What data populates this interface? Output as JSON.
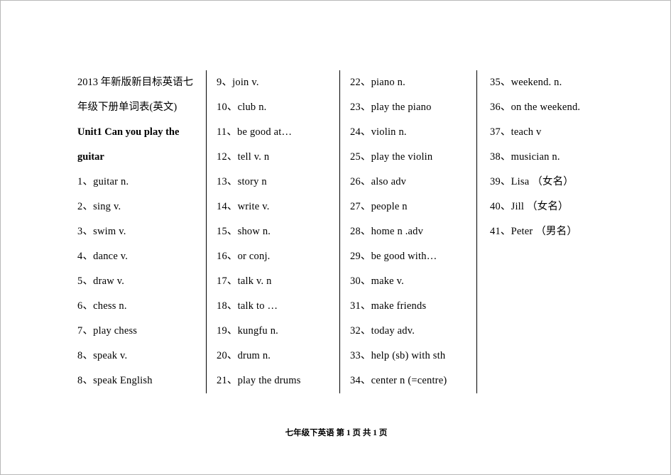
{
  "document": {
    "footer": "七年级下英语   第 1 页 共 1 页",
    "columns": [
      {
        "id": "column-1",
        "lines": [
          {
            "text": "2013 年新版新目标英语七",
            "bold": false
          },
          {
            "text": "年级下册单词表(英文)",
            "bold": false
          },
          {
            "text": "Unit1    Can you play the",
            "bold": true
          },
          {
            "text": "guitar",
            "bold": true
          },
          {
            "text": "1、guitar    n.",
            "bold": false
          },
          {
            "text": "2、sing    v.",
            "bold": false
          },
          {
            "text": "3、swim    v.",
            "bold": false
          },
          {
            "text": "4、dance    v.",
            "bold": false
          },
          {
            "text": "5、draw    v.",
            "bold": false
          },
          {
            "text": "6、chess    n.",
            "bold": false
          },
          {
            "text": "7、play    chess",
            "bold": false
          },
          {
            "text": "8、speak    v.",
            "bold": false
          },
          {
            "text": "8、speak    English",
            "bold": false
          }
        ]
      },
      {
        "id": "column-2",
        "lines": [
          {
            "text": "9、join    v.",
            "bold": false
          },
          {
            "text": "10、club    n.",
            "bold": false
          },
          {
            "text": "11、be good at…",
            "bold": false
          },
          {
            "text": "12、tell    v. n",
            "bold": false
          },
          {
            "text": "13、story    n",
            "bold": false
          },
          {
            "text": "14、write    v.",
            "bold": false
          },
          {
            "text": "15、show    n.",
            "bold": false
          },
          {
            "text": "16、or    conj.",
            "bold": false
          },
          {
            "text": "17、talk    v. n",
            "bold": false
          },
          {
            "text": "18、talk    to …",
            "bold": false
          },
          {
            "text": "19、kungfu    n.",
            "bold": false
          },
          {
            "text": "20、drum    n.",
            "bold": false
          },
          {
            "text": "21、play the drums",
            "bold": false
          }
        ]
      },
      {
        "id": "column-3",
        "lines": [
          {
            "text": "22、piano    n.",
            "bold": false
          },
          {
            "text": "23、play the piano",
            "bold": false
          },
          {
            "text": "24、violin    n.",
            "bold": false
          },
          {
            "text": "25、play the violin",
            "bold": false
          },
          {
            "text": "26、also    adv",
            "bold": false
          },
          {
            "text": "27、people    n",
            "bold": false
          },
          {
            "text": "28、home    n .adv",
            "bold": false
          },
          {
            "text": "29、be good with…",
            "bold": false
          },
          {
            "text": "30、make    v.",
            "bold": false
          },
          {
            "text": "31、make friends",
            "bold": false
          },
          {
            "text": "32、today    adv.",
            "bold": false
          },
          {
            "text": "33、help (sb) with sth",
            "bold": false
          },
          {
            "text": "34、center    n (=centre)",
            "bold": false
          }
        ]
      },
      {
        "id": "column-4",
        "lines": [
          {
            "text": "35、weekend. n.",
            "bold": false
          },
          {
            "text": "36、on the weekend.",
            "bold": false
          },
          {
            "text": "37、teach    v",
            "bold": false
          },
          {
            "text": "38、musician    n.",
            "bold": false
          },
          {
            "text": "39、Lisa    （女名）",
            "bold": false
          },
          {
            "text": "40、Jill    （女名）",
            "bold": false
          },
          {
            "text": "41、Peter    （男名）",
            "bold": false
          }
        ]
      }
    ]
  }
}
